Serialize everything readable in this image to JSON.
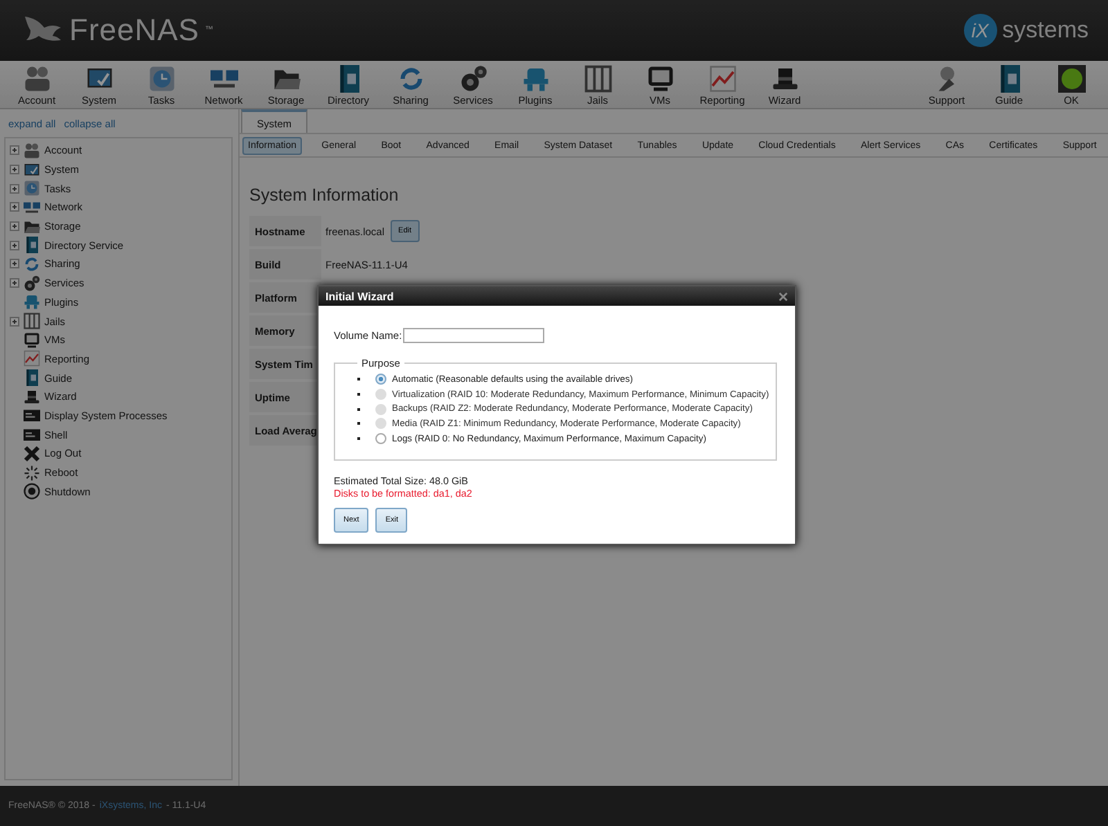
{
  "header": {
    "logo_text": "FreeNAS",
    "logo_mark": "™",
    "vendor_mark": "iX",
    "vendor_text": "systems"
  },
  "toolbar": {
    "left": [
      {
        "label": "Account"
      },
      {
        "label": "System"
      },
      {
        "label": "Tasks"
      },
      {
        "label": "Network"
      },
      {
        "label": "Storage"
      },
      {
        "label": "Directory"
      },
      {
        "label": "Sharing"
      },
      {
        "label": "Services"
      },
      {
        "label": "Plugins"
      },
      {
        "label": "Jails"
      },
      {
        "label": "VMs"
      },
      {
        "label": "Reporting"
      },
      {
        "label": "Wizard"
      }
    ],
    "right": [
      {
        "label": "Support"
      },
      {
        "label": "Guide"
      },
      {
        "label": "OK"
      }
    ]
  },
  "sidebar": {
    "links": [
      "expand all",
      "collapse all"
    ],
    "items": [
      {
        "label": "Account",
        "expandable": true
      },
      {
        "label": "System",
        "expandable": true
      },
      {
        "label": "Tasks",
        "expandable": true
      },
      {
        "label": "Network",
        "expandable": true
      },
      {
        "label": "Storage",
        "expandable": true
      },
      {
        "label": "Directory Service",
        "expandable": true
      },
      {
        "label": "Sharing",
        "expandable": true
      },
      {
        "label": "Services",
        "expandable": true
      },
      {
        "label": "Plugins",
        "expandable": false
      },
      {
        "label": "Jails",
        "expandable": true
      },
      {
        "label": "VMs",
        "expandable": false
      },
      {
        "label": "Reporting",
        "expandable": false
      },
      {
        "label": "Guide",
        "expandable": false
      },
      {
        "label": "Wizard",
        "expandable": false
      },
      {
        "label": "Display System Processes",
        "expandable": false
      },
      {
        "label": "Shell",
        "expandable": false
      },
      {
        "label": "Log Out",
        "expandable": false
      },
      {
        "label": "Reboot",
        "expandable": false
      },
      {
        "label": "Shutdown",
        "expandable": false
      }
    ]
  },
  "tabs": [
    {
      "label": "System",
      "selected": true
    }
  ],
  "subtabs": [
    {
      "label": "Information",
      "selected": true
    },
    {
      "label": "General",
      "selected": false
    },
    {
      "label": "Boot",
      "selected": false
    },
    {
      "label": "Advanced",
      "selected": false
    },
    {
      "label": "Email",
      "selected": false
    },
    {
      "label": "System Dataset",
      "selected": false
    },
    {
      "label": "Tunables",
      "selected": false
    },
    {
      "label": "Update",
      "selected": false
    },
    {
      "label": "Cloud Credentials",
      "selected": false
    },
    {
      "label": "Alert Services",
      "selected": false
    },
    {
      "label": "CAs",
      "selected": false
    },
    {
      "label": "Certificates",
      "selected": false
    },
    {
      "label": "Support",
      "selected": false
    }
  ],
  "info": {
    "title": "System Information",
    "edit_button": "Edit",
    "rows": [
      {
        "label": "Hostname",
        "value": "freenas.local"
      },
      {
        "label": "Build",
        "value": "FreeNAS-11.1-U4"
      },
      {
        "label": "Platform"
      },
      {
        "label": "Memory"
      },
      {
        "label": "System Tim"
      },
      {
        "label": "Uptime"
      },
      {
        "label": "Load Averag"
      }
    ]
  },
  "dialog": {
    "title": "Initial Wizard",
    "volume_label": "Volume Name:",
    "purpose_title": "Purpose",
    "options": [
      {
        "label": "Automatic (Reasonable defaults using the available drives)",
        "selected": true,
        "disabled": false
      },
      {
        "label": "Virtualization (RAID 10: Moderate Redundancy, Maximum Performance, Minimum Capacity)",
        "selected": false,
        "disabled": true
      },
      {
        "label": "Backups (RAID Z2: Moderate Redundancy, Moderate Performance, Moderate Capacity)",
        "selected": false,
        "disabled": true
      },
      {
        "label": "Media (RAID Z1: Minimum Redundancy, Moderate Performance, Moderate Capacity)",
        "selected": false,
        "disabled": true
      },
      {
        "label": "Logs (RAID 0: No Redundancy, Maximum Performance, Maximum Capacity)",
        "selected": false,
        "disabled": false
      }
    ],
    "total": "Estimated Total Size: 48.0 GiB",
    "disks": "Disks to be formatted: da1, da2",
    "buttons": [
      "Next",
      "Exit"
    ]
  },
  "footer": {
    "prefix": "FreeNAS® © 2018 -",
    "link": "iXsystems, Inc",
    "suffix": "- 11.1-U4"
  }
}
